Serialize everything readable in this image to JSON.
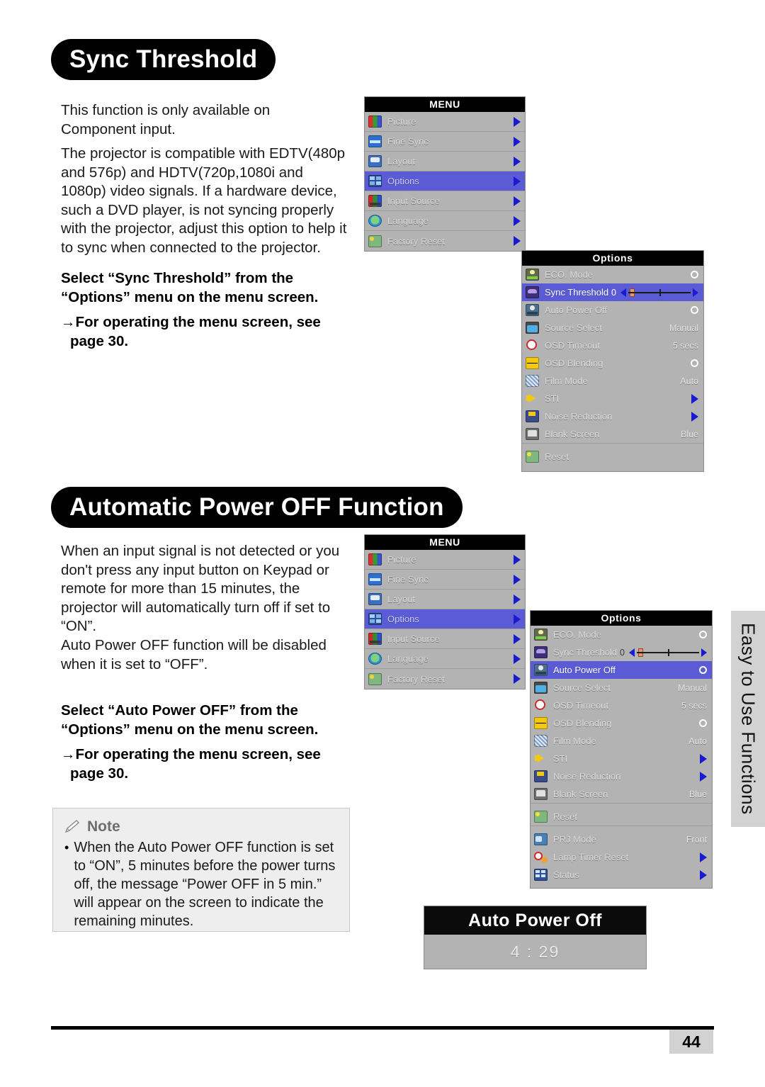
{
  "sections": [
    {
      "heading": "Sync Threshold",
      "paragraphs": [
        "This function is only available on Component input.",
        "The projector is compatible with EDTV(480p and 576p) and HDTV(720p,1080i and 1080p) video signals. If a hardware device, such a DVD player, is not syncing properly with the projector, adjust this option to help it to sync when connected to the projector."
      ],
      "instruction_line1": "Select “Sync Threshold” from the “Options” menu on the menu screen.",
      "instruction_line2": "→For operating the menu screen, see page 30."
    },
    {
      "heading": "Automatic Power OFF Function",
      "paragraphs": [
        "When an input signal is not detected or you don't press any input button on Keypad or remote for more than 15 minutes, the projector will automatically turn off if set to “ON”.",
        "Auto Power OFF function will be disabled when it is set to “OFF”."
      ],
      "instruction_line1": "Select “Auto Power OFF” from the “Options” menu on the menu screen.",
      "instruction_line2": "→For operating the menu screen, see page 30."
    }
  ],
  "note": {
    "title": "Note",
    "icon": "pencil-icon",
    "bullet": "•",
    "text": "When the Auto Power OFF function is set to “ON”, 5 minutes before the power turns off, the message “Power OFF in 5 min.” will appear on the screen to indicate the remaining minutes."
  },
  "osd_menu": {
    "title": "MENU",
    "items": [
      {
        "label": "Picture",
        "icon": "picture-icon",
        "selected": false
      },
      {
        "label": "Fine Sync",
        "icon": "fine-sync-icon",
        "selected": false
      },
      {
        "label": "Layout",
        "icon": "layout-icon",
        "selected": false
      },
      {
        "label": "Options",
        "icon": "options-icon",
        "selected": true
      },
      {
        "label": "Input Source",
        "icon": "input-source-icon",
        "selected": false
      },
      {
        "label": "Language",
        "icon": "language-icon",
        "selected": false
      },
      {
        "label": "Factory Reset",
        "icon": "factory-reset-icon",
        "selected": false
      }
    ]
  },
  "osd_options_top": {
    "title": "Options",
    "items": [
      {
        "label": "ECO. Mode",
        "icon": "eco-mode-icon",
        "control": "radio",
        "value": "",
        "selected": false
      },
      {
        "label": "Sync Threshold",
        "icon": "sync-threshold-icon",
        "control": "slider",
        "value": "0",
        "selected": true
      },
      {
        "label": "Auto Power Off",
        "icon": "auto-power-off-icon",
        "control": "radio",
        "value": "",
        "selected": false
      },
      {
        "label": "Source Select",
        "icon": "source-select-icon",
        "control": "text",
        "value": "Manual",
        "selected": false
      },
      {
        "label": "OSD Timeout",
        "icon": "osd-timeout-icon",
        "control": "text",
        "value": "5 secs",
        "selected": false
      },
      {
        "label": "OSD Blending",
        "icon": "osd-blending-icon",
        "control": "radio",
        "value": "",
        "selected": false
      },
      {
        "label": "Film Mode",
        "icon": "film-mode-icon",
        "control": "text",
        "value": "Auto",
        "selected": false
      },
      {
        "label": "STI",
        "icon": "sti-icon",
        "control": "arrow",
        "value": "",
        "selected": false
      },
      {
        "label": "Noise Reduction",
        "icon": "noise-reduction-icon",
        "control": "arrow",
        "value": "",
        "selected": false
      },
      {
        "label": "Blank Screen",
        "icon": "blank-screen-icon",
        "control": "text",
        "value": "Blue",
        "selected": false
      },
      {
        "label": "__GAP__",
        "icon": "",
        "control": "gap",
        "value": "",
        "selected": false
      },
      {
        "label": "Reset",
        "icon": "reset-icon",
        "control": "none",
        "value": "",
        "selected": false
      }
    ]
  },
  "osd_options_bottom": {
    "title": "Options",
    "items": [
      {
        "label": "ECO. Mode",
        "icon": "eco-mode-icon",
        "control": "radio",
        "value": "",
        "selected": false
      },
      {
        "label": "Sync Threshold",
        "icon": "sync-threshold-icon",
        "control": "slider",
        "value": "0",
        "selected": false
      },
      {
        "label": "Auto Power Off",
        "icon": "auto-power-off-icon",
        "control": "radio",
        "value": "",
        "selected": true
      },
      {
        "label": "Source Select",
        "icon": "source-select-icon",
        "control": "text",
        "value": "Manual",
        "selected": false
      },
      {
        "label": "OSD Timeout",
        "icon": "osd-timeout-icon",
        "control": "text",
        "value": "5 secs",
        "selected": false
      },
      {
        "label": "OSD Blending",
        "icon": "osd-blending-icon",
        "control": "radio",
        "value": "",
        "selected": false
      },
      {
        "label": "Film Mode",
        "icon": "film-mode-icon",
        "control": "text",
        "value": "Auto",
        "selected": false
      },
      {
        "label": "STI",
        "icon": "sti-icon",
        "control": "arrow",
        "value": "",
        "selected": false
      },
      {
        "label": "Noise Reduction",
        "icon": "noise-reduction-icon",
        "control": "arrow",
        "value": "",
        "selected": false
      },
      {
        "label": "Blank Screen",
        "icon": "blank-screen-icon",
        "control": "text",
        "value": "Blue",
        "selected": false
      },
      {
        "label": "__GAP__",
        "icon": "",
        "control": "gap",
        "value": "",
        "selected": false
      },
      {
        "label": "Reset",
        "icon": "reset-icon",
        "control": "none",
        "value": "",
        "selected": false
      },
      {
        "label": "__GAP__",
        "icon": "",
        "control": "gap",
        "value": "",
        "selected": false
      },
      {
        "label": "PRJ Mode",
        "icon": "prj-mode-icon",
        "control": "text",
        "value": "Front",
        "selected": false
      },
      {
        "label": "Lamp Timer Reset",
        "icon": "lamp-timer-icon",
        "control": "arrow",
        "value": "",
        "selected": false
      },
      {
        "label": "Status",
        "icon": "status-icon",
        "control": "arrow",
        "value": "",
        "selected": false
      }
    ]
  },
  "osd_auto_power_off": {
    "title": "Auto Power Off",
    "countdown": "4 : 29"
  },
  "side_tab": {
    "label": "Easy to Use Functions"
  },
  "footer": {
    "page_number": "44"
  },
  "colors": {
    "osd_background": "#b3b3b3",
    "osd_header": "#000000",
    "osd_highlight": "#5b5bd6",
    "arrow_blue": "#1a1ad0",
    "note_background": "#eeeeee",
    "side_tab": "#d2d2d2"
  }
}
